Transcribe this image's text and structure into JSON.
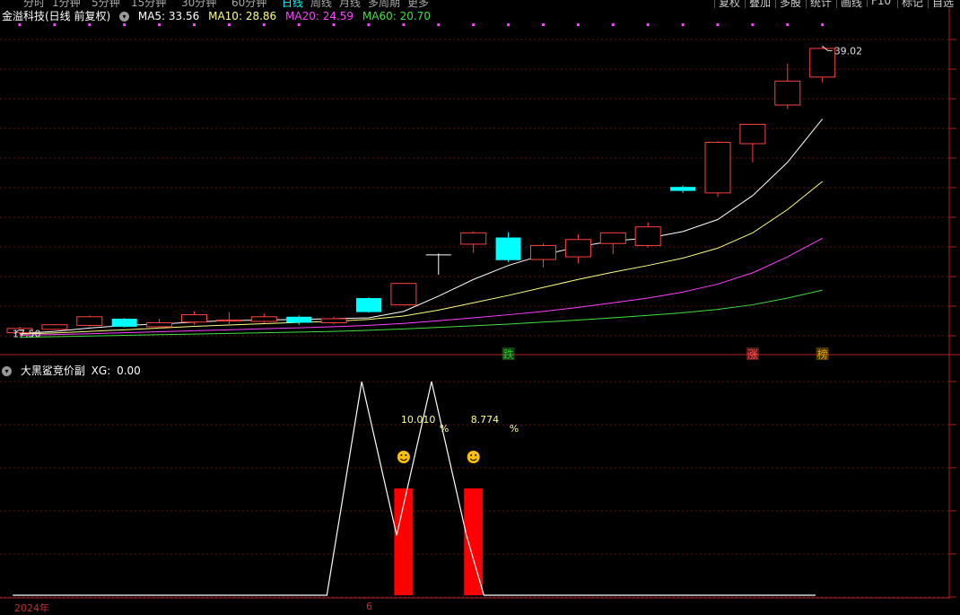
{
  "toolbar": {
    "periods": [
      {
        "label": "分时",
        "active": false
      },
      {
        "label": "1分钟",
        "active": false
      },
      {
        "label": "5分钟",
        "active": false
      },
      {
        "label": "15分钟",
        "active": false
      },
      {
        "label": "30分钟",
        "active": false
      },
      {
        "label": "60分钟",
        "active": false
      },
      {
        "label": "日线",
        "active": true
      },
      {
        "label": "周线",
        "active": false
      },
      {
        "label": "月线",
        "active": false
      },
      {
        "label": "多周期",
        "active": false
      },
      {
        "label": "更多",
        "active": false
      }
    ],
    "buttons": [
      "复权",
      "叠加",
      "多股",
      "统计",
      "画线",
      "F10",
      "标记",
      "自选"
    ]
  },
  "main_legend": {
    "stock_title": "金溢科技(日线 前复权)",
    "ma5": {
      "label": "MA5:",
      "value": "33.56",
      "color": "#ffffff"
    },
    "ma10": {
      "label": "MA10:",
      "value": "28.86",
      "color": "#ffff80"
    },
    "ma20": {
      "label": "MA20:",
      "value": "24.59",
      "color": "#ff40ff"
    },
    "ma60": {
      "label": "MA60:",
      "value": "20.70",
      "color": "#40e040"
    }
  },
  "price_markers": {
    "high": "39.02",
    "low": "17.50"
  },
  "event_tags": [
    {
      "text": "跌",
      "color": "#30c030",
      "candle": 14
    },
    {
      "text": "涨",
      "color": "#ff5050",
      "candle": 21
    },
    {
      "text": "榜",
      "color": "#e0a000",
      "candle": 23
    }
  ],
  "sub_legend": {
    "title": "大黑鲨竞价副",
    "xg_label": "XG:",
    "xg_value": "0.00"
  },
  "indicator_labels": [
    {
      "value": "10.010",
      "unit": "%"
    },
    {
      "value": "8.774",
      "unit": "%"
    }
  ],
  "axis": {
    "year_label": "2024年",
    "month_label": "6"
  },
  "chart_data": {
    "type": "candlestick",
    "y_axis": {
      "ymin": 17.0,
      "ymax": 40.6
    },
    "colors": {
      "up": "#ff4040",
      "down": "#00ffff",
      "ma5": "#ffffff",
      "ma10": "#ffff80",
      "ma20": "#ff40ff",
      "ma60": "#40e040"
    },
    "candles": [
      {
        "o": 17.5,
        "h": 17.95,
        "l": 17.4,
        "c": 17.82
      },
      {
        "o": 17.75,
        "h": 18.15,
        "l": 17.7,
        "c": 18.1
      },
      {
        "o": 18.05,
        "h": 18.8,
        "l": 17.95,
        "c": 18.7
      },
      {
        "o": 18.55,
        "h": 18.6,
        "l": 17.9,
        "c": 17.95
      },
      {
        "o": 17.95,
        "h": 18.55,
        "l": 17.8,
        "c": 18.25
      },
      {
        "o": 18.3,
        "h": 19.1,
        "l": 18.1,
        "c": 18.85
      },
      {
        "o": 18.4,
        "h": 19.05,
        "l": 18.15,
        "c": 18.45
      },
      {
        "o": 18.35,
        "h": 18.95,
        "l": 18.2,
        "c": 18.7
      },
      {
        "o": 18.7,
        "h": 18.8,
        "l": 18.1,
        "c": 18.25
      },
      {
        "o": 18.25,
        "h": 18.7,
        "l": 18.15,
        "c": 18.55
      },
      {
        "o": 20.1,
        "h": 20.15,
        "l": 19.0,
        "c": 19.05
      },
      {
        "o": 19.6,
        "h": 21.2,
        "l": 19.55,
        "c": 21.2
      },
      {
        "o": 23.35,
        "h": 23.45,
        "l": 21.85,
        "c": 23.35
      },
      {
        "o": 24.15,
        "h": 25.1,
        "l": 23.5,
        "c": 25.0
      },
      {
        "o": 24.65,
        "h": 25.05,
        "l": 22.8,
        "c": 22.95
      },
      {
        "o": 23.0,
        "h": 24.2,
        "l": 22.4,
        "c": 24.05
      },
      {
        "o": 23.2,
        "h": 24.9,
        "l": 22.7,
        "c": 24.5
      },
      {
        "o": 24.2,
        "h": 25.0,
        "l": 23.4,
        "c": 25.0
      },
      {
        "o": 24.05,
        "h": 25.8,
        "l": 23.9,
        "c": 25.45
      },
      {
        "o": 28.45,
        "h": 28.55,
        "l": 28.0,
        "c": 28.15
      },
      {
        "o": 28.0,
        "h": 31.9,
        "l": 27.7,
        "c": 31.8
      },
      {
        "o": 31.7,
        "h": 33.15,
        "l": 30.3,
        "c": 33.15
      },
      {
        "o": 34.6,
        "h": 37.7,
        "l": 34.3,
        "c": 36.4
      },
      {
        "o": 36.7,
        "h": 39.02,
        "l": 36.3,
        "c": 38.85
      }
    ],
    "ma5": [
      17.45,
      17.6,
      17.85,
      18.05,
      18.15,
      18.3,
      18.42,
      18.45,
      18.5,
      18.55,
      18.62,
      19.1,
      20.25,
      21.5,
      22.55,
      23.35,
      23.95,
      24.4,
      24.6,
      25.1,
      26.0,
      27.8,
      30.3,
      33.56
    ],
    "ma10": [
      17.4,
      17.48,
      17.6,
      17.72,
      17.85,
      17.98,
      18.08,
      18.18,
      18.27,
      18.36,
      18.5,
      18.75,
      19.2,
      19.75,
      20.3,
      20.9,
      21.5,
      22.05,
      22.55,
      23.1,
      23.85,
      25.0,
      26.75,
      28.86
    ],
    "ma20": [
      17.3,
      17.36,
      17.42,
      17.5,
      17.57,
      17.65,
      17.72,
      17.8,
      17.87,
      17.95,
      18.05,
      18.2,
      18.4,
      18.62,
      18.85,
      19.1,
      19.4,
      19.75,
      20.1,
      20.55,
      21.15,
      22.0,
      23.2,
      24.59
    ],
    "ma60": [
      17.15,
      17.2,
      17.25,
      17.3,
      17.35,
      17.4,
      17.45,
      17.5,
      17.55,
      17.6,
      17.68,
      17.78,
      17.9,
      18.02,
      18.15,
      18.3,
      18.45,
      18.62,
      18.8,
      19.0,
      19.25,
      19.6,
      20.1,
      20.7
    ],
    "indicator": {
      "line_points": [
        [
          0,
          0
        ],
        [
          9,
          0
        ],
        [
          10,
          1
        ],
        [
          11,
          0.28
        ],
        [
          12,
          1
        ],
        [
          13,
          0.28
        ],
        [
          13.5,
          0
        ],
        [
          23,
          0
        ]
      ],
      "bars": [
        {
          "at": 11,
          "value": 0.5
        },
        {
          "at": 13,
          "value": 0.5
        }
      ]
    }
  }
}
